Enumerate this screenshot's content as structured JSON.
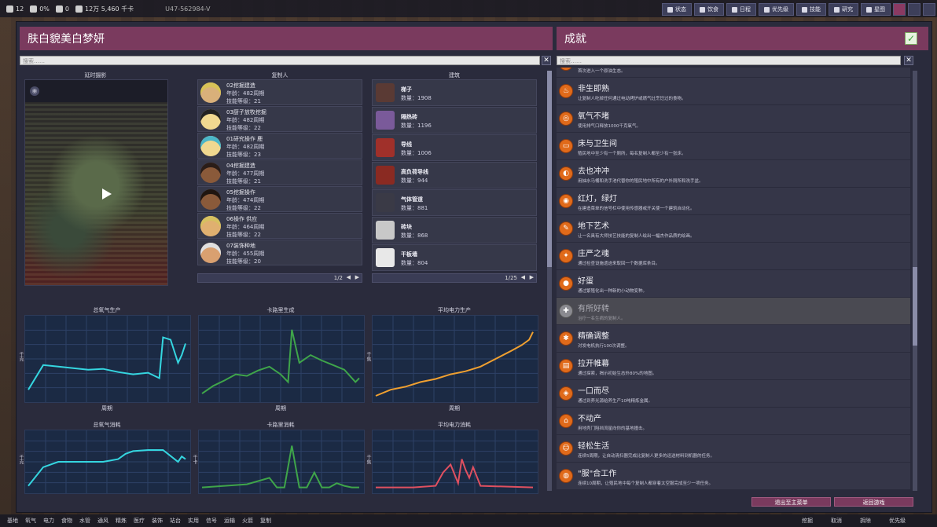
{
  "topbar": {
    "stats": [
      {
        "icon": "duplicant-icon",
        "value": "12"
      },
      {
        "icon": "stress-icon",
        "value": "0%"
      },
      {
        "icon": "sickness-icon",
        "value": "0"
      },
      {
        "icon": "food-icon",
        "value": "12万 5,460 千卡"
      }
    ],
    "seed": "U47-562984-V",
    "buttons": [
      "状态",
      "饮食",
      "日程",
      "优先级",
      "技能",
      "研究",
      "星图"
    ]
  },
  "left_panel": {
    "title": "肤白貌美白梦妍",
    "search_placeholder": "搜索……",
    "timelapse_label": "延时摄影",
    "duplicants_label": "复制人",
    "buildings_label": "建筑",
    "duplicants": [
      {
        "name": "02挖掘建造",
        "age": "年龄：482周期",
        "skill": "技能等级：21",
        "hair": "h1"
      },
      {
        "name": "03厨子放牧挖掘",
        "age": "年龄：482周期",
        "skill": "技能等级：22",
        "hair": "h2"
      },
      {
        "name": "01研究操作 鹿",
        "age": "年龄：482周期",
        "skill": "技能等级：23",
        "hair": "h3"
      },
      {
        "name": "04挖掘建造",
        "age": "年龄：477周期",
        "skill": "技能等级：21",
        "hair": "h4"
      },
      {
        "name": "05挖掘操作",
        "age": "年龄：474周期",
        "skill": "技能等级：22",
        "hair": "h5"
      },
      {
        "name": "06操作 供应",
        "age": "年龄：464周期",
        "skill": "技能等级：22",
        "hair": "h6"
      },
      {
        "name": "07装饰种地",
        "age": "年龄：455周期",
        "skill": "技能等级：20",
        "hair": "h7"
      }
    ],
    "duplicant_page": "1/2",
    "buildings": [
      {
        "name": "梯子",
        "count": "数量：1908",
        "color": "#5a3a34"
      },
      {
        "name": "隔热砖",
        "count": "数量：1196",
        "color": "#7a5a9a"
      },
      {
        "name": "导线",
        "count": "数量：1006",
        "color": "#a0302a"
      },
      {
        "name": "高负荷导线",
        "count": "数量：944",
        "color": "#8a2a22"
      },
      {
        "name": "气体管道",
        "count": "数量：881",
        "color": "#3a3a46"
      },
      {
        "name": "砖块",
        "count": "数量：868",
        "color": "#c8c8c8"
      },
      {
        "name": "干板墙",
        "count": "数量：804",
        "color": "#e8e8e8"
      }
    ],
    "building_page": "1/25"
  },
  "chart_data": [
    {
      "type": "line",
      "title": "总氧气生产",
      "xlabel": "周期",
      "ylabel": "千克",
      "color": "#35d6e0",
      "x": [
        0,
        20,
        40,
        60,
        80,
        100,
        120,
        140,
        160,
        175,
        180,
        190,
        200,
        205,
        210
      ],
      "values": [
        0.1,
        0.42,
        0.4,
        0.38,
        0.36,
        0.37,
        0.33,
        0.3,
        0.32,
        0.25,
        0.78,
        0.75,
        0.45,
        0.55,
        0.7
      ]
    },
    {
      "type": "line",
      "title": "卡路里生成",
      "xlabel": "周期",
      "color": "#3fa54a",
      "x": [
        0,
        15,
        30,
        45,
        60,
        75,
        90,
        105,
        115,
        120,
        130,
        145,
        160,
        175,
        190,
        205,
        210
      ],
      "values": [
        0.05,
        0.15,
        0.22,
        0.3,
        0.28,
        0.35,
        0.4,
        0.3,
        0.2,
        0.88,
        0.45,
        0.55,
        0.48,
        0.42,
        0.36,
        0.2,
        0.25
      ]
    },
    {
      "type": "line",
      "title": "平均电力生产",
      "xlabel": "周期",
      "ylabel": "千焦",
      "color": "#f0a030",
      "x": [
        0,
        20,
        40,
        60,
        80,
        100,
        120,
        140,
        160,
        180,
        195,
        205,
        210
      ],
      "values": [
        0.02,
        0.1,
        0.14,
        0.2,
        0.24,
        0.3,
        0.34,
        0.4,
        0.5,
        0.6,
        0.68,
        0.75,
        0.85
      ]
    },
    {
      "type": "line",
      "title": "总氧气消耗",
      "ylabel": "千克",
      "color": "#35d6e0",
      "x": [
        0,
        20,
        40,
        60,
        80,
        100,
        120,
        130,
        140,
        160,
        180,
        200,
        205,
        210
      ],
      "values": [
        0.05,
        0.4,
        0.5,
        0.5,
        0.5,
        0.5,
        0.55,
        0.65,
        0.7,
        0.72,
        0.72,
        0.5,
        0.6,
        0.55
      ]
    },
    {
      "type": "line",
      "title": "卡路里消耗",
      "ylabel": "千卡",
      "color": "#3fa54a",
      "x": [
        0,
        30,
        60,
        90,
        100,
        110,
        120,
        130,
        140,
        150,
        160,
        170,
        180,
        190,
        200,
        210
      ],
      "values": [
        0.02,
        0.05,
        0.08,
        0.2,
        0.02,
        0.02,
        0.8,
        0.02,
        0.02,
        0.3,
        0.02,
        0.02,
        0.1,
        0.05,
        0.02,
        0.02
      ]
    },
    {
      "type": "line",
      "title": "平均电力消耗",
      "ylabel": "千焦",
      "color": "#e05060",
      "x": [
        0,
        50,
        80,
        90,
        100,
        110,
        115,
        120,
        125,
        130,
        140,
        210
      ],
      "values": [
        0.02,
        0.02,
        0.05,
        0.3,
        0.45,
        0.1,
        0.55,
        0.35,
        0.2,
        0.4,
        0.05,
        0.02
      ]
    }
  ],
  "right_panel": {
    "title": "成就",
    "search_placeholder": "搜索……",
    "achievements": [
      {
        "name": "开荒",
        "desc": "首次进入一个原油生态。",
        "icon": "drop",
        "dim": false
      },
      {
        "name": "非生即熟",
        "desc": "让复制人吃掉任何通过电动烤炉或燃气灶烹饪过的食物。",
        "icon": "cook",
        "dim": false
      },
      {
        "name": "氧气不堵",
        "desc": "使用排气口释放1000千克氧气。",
        "icon": "o2",
        "dim": false
      },
      {
        "name": "床与卫生间",
        "desc": "殖民地中至少有一个厕所，每名复制人都至少有一张床。",
        "icon": "bed",
        "dim": false
      },
      {
        "name": "去也冲冲",
        "desc": "用抽水马桶和洗手池代替你的殖民地中所有的户外厕所和洗手盆。",
        "icon": "toilet",
        "dim": false
      },
      {
        "name": "红灯，绿灯",
        "desc": "在建造菜单的信号栏中使用传感器或开关使一个建筑自动化。",
        "icon": "light",
        "dim": false
      },
      {
        "name": "地下艺术",
        "desc": "让一名具有大师技艺技能的复制人绘出一幅杰作品质的绘画。",
        "icon": "art",
        "dim": false
      },
      {
        "name": "庄严之魂",
        "desc": "通过检查设施遗迹来取回一个数据库条目。",
        "icon": "soul",
        "dim": false
      },
      {
        "name": "好蛋",
        "desc": "通过繁殖化出一种新的小动物变种。",
        "icon": "egg",
        "dim": false
      },
      {
        "name": "有所好转",
        "desc": "治疗一名生病的复制人。",
        "icon": "heal",
        "dim": true
      },
      {
        "name": "精确调整",
        "desc": "对发电机执行100次调整。",
        "icon": "tune",
        "dim": false
      },
      {
        "name": "拉开帷幕",
        "desc": "通过探索，揭示初始生态外80%的地图。",
        "icon": "curtain",
        "dim": false
      },
      {
        "name": "一口而尽",
        "desc": "通过到养光源给养生产10吨精炼金属。",
        "icon": "metal",
        "dim": false
      },
      {
        "name": "不动产",
        "desc": "用地壳门阻挡流星向你的基地撞击。",
        "icon": "home",
        "dim": false
      },
      {
        "name": "轻松生活",
        "desc": "连续5周期，让自动清扫器完成比复制人更多的运送材料到机器的任务。",
        "icon": "easy",
        "dim": false
      },
      {
        "name": "\"服\"合工作",
        "desc": "连续10周期，让殖民地中每个复制人都穿着太空服完成至少一项任务。",
        "icon": "suit",
        "dim": false
      }
    ]
  },
  "buttons": {
    "exit_main_menu": "退出至主菜单",
    "return_game": "返回游戏"
  },
  "bottombar": {
    "items": [
      "基地",
      "氧气",
      "电力",
      "食物",
      "水管",
      "通风",
      "精炼",
      "医疗",
      "装饰",
      "站台",
      "实用",
      "信号",
      "运输",
      "火箭",
      "复制"
    ],
    "right_items": [
      "挖掘",
      "取消",
      "拆除",
      "优先级"
    ]
  }
}
